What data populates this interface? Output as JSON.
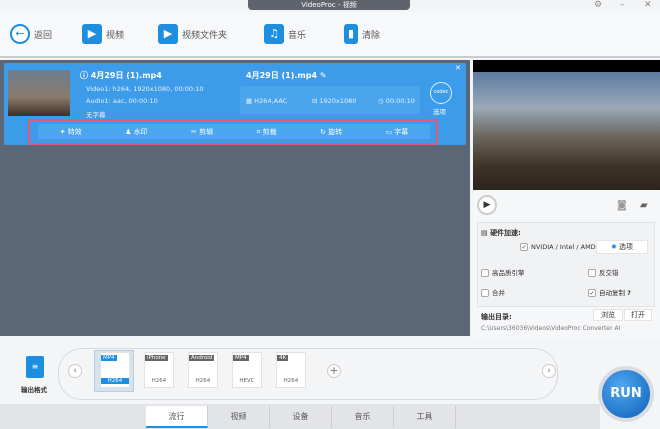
{
  "window": {
    "title": "VideoProc - 视频"
  },
  "toolbar": {
    "back": "返回",
    "video": "视频",
    "folder": "视频文件夹",
    "music": "音乐",
    "clear": "清除"
  },
  "file": {
    "source_name": "4月29日 (1).mp4",
    "video_track": "Video1: h264, 1920x1080, 00:00:10",
    "audio_track": "Audio1: aac, 00:00:10",
    "subtitle": "无字幕",
    "output_name": "4月29日 (1).mp4",
    "codec": "H264,AAC",
    "resolution": "1920x1080",
    "duration": "00:00:10",
    "options": "选项",
    "codec_badge": "codec"
  },
  "effects": [
    "特效",
    "水印",
    "剪辑",
    "剪裁",
    "旋转",
    "字幕"
  ],
  "settings": {
    "hw_accel": "硬件加速:",
    "hw_option": "NVIDIA / Intel / AMD",
    "options_btn": "选项",
    "high_quality": "高品质引擎",
    "deinterlace": "反交错",
    "merge": "合并",
    "auto_copy": "自动复制",
    "help": "?",
    "output_dir": "输出目录:",
    "browse": "浏览",
    "open": "打开",
    "path": "C:\\Users\\36036\\Videos\\VideoProc Converter AI"
  },
  "bottom": {
    "output_format": "输出格式",
    "formats": [
      {
        "tag": "MP4",
        "codec": "H264"
      },
      {
        "tag": "iPhone",
        "codec": "H264"
      },
      {
        "tag": "Android",
        "codec": "H264"
      },
      {
        "tag": "MP4",
        "codec": "HEVC"
      },
      {
        "tag": "4K",
        "codec": "H264"
      }
    ],
    "tabs": [
      "流行",
      "视频",
      "设备",
      "音乐",
      "工具"
    ],
    "run": "RUN"
  }
}
